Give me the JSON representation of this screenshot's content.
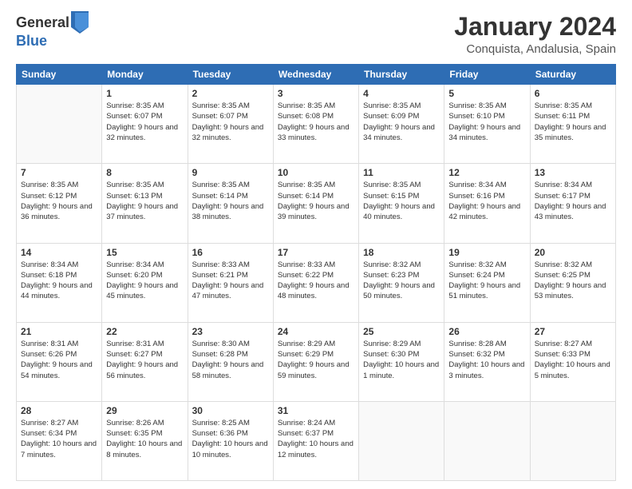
{
  "header": {
    "logo_general": "General",
    "logo_blue": "Blue",
    "month": "January 2024",
    "location": "Conquista, Andalusia, Spain"
  },
  "weekdays": [
    "Sunday",
    "Monday",
    "Tuesday",
    "Wednesday",
    "Thursday",
    "Friday",
    "Saturday"
  ],
  "weeks": [
    [
      {
        "day": "",
        "sunrise": "",
        "sunset": "",
        "daylight": ""
      },
      {
        "day": "1",
        "sunrise": "Sunrise: 8:35 AM",
        "sunset": "Sunset: 6:07 PM",
        "daylight": "Daylight: 9 hours and 32 minutes."
      },
      {
        "day": "2",
        "sunrise": "Sunrise: 8:35 AM",
        "sunset": "Sunset: 6:07 PM",
        "daylight": "Daylight: 9 hours and 32 minutes."
      },
      {
        "day": "3",
        "sunrise": "Sunrise: 8:35 AM",
        "sunset": "Sunset: 6:08 PM",
        "daylight": "Daylight: 9 hours and 33 minutes."
      },
      {
        "day": "4",
        "sunrise": "Sunrise: 8:35 AM",
        "sunset": "Sunset: 6:09 PM",
        "daylight": "Daylight: 9 hours and 34 minutes."
      },
      {
        "day": "5",
        "sunrise": "Sunrise: 8:35 AM",
        "sunset": "Sunset: 6:10 PM",
        "daylight": "Daylight: 9 hours and 34 minutes."
      },
      {
        "day": "6",
        "sunrise": "Sunrise: 8:35 AM",
        "sunset": "Sunset: 6:11 PM",
        "daylight": "Daylight: 9 hours and 35 minutes."
      }
    ],
    [
      {
        "day": "7",
        "sunrise": "Sunrise: 8:35 AM",
        "sunset": "Sunset: 6:12 PM",
        "daylight": "Daylight: 9 hours and 36 minutes."
      },
      {
        "day": "8",
        "sunrise": "Sunrise: 8:35 AM",
        "sunset": "Sunset: 6:13 PM",
        "daylight": "Daylight: 9 hours and 37 minutes."
      },
      {
        "day": "9",
        "sunrise": "Sunrise: 8:35 AM",
        "sunset": "Sunset: 6:14 PM",
        "daylight": "Daylight: 9 hours and 38 minutes."
      },
      {
        "day": "10",
        "sunrise": "Sunrise: 8:35 AM",
        "sunset": "Sunset: 6:14 PM",
        "daylight": "Daylight: 9 hours and 39 minutes."
      },
      {
        "day": "11",
        "sunrise": "Sunrise: 8:35 AM",
        "sunset": "Sunset: 6:15 PM",
        "daylight": "Daylight: 9 hours and 40 minutes."
      },
      {
        "day": "12",
        "sunrise": "Sunrise: 8:34 AM",
        "sunset": "Sunset: 6:16 PM",
        "daylight": "Daylight: 9 hours and 42 minutes."
      },
      {
        "day": "13",
        "sunrise": "Sunrise: 8:34 AM",
        "sunset": "Sunset: 6:17 PM",
        "daylight": "Daylight: 9 hours and 43 minutes."
      }
    ],
    [
      {
        "day": "14",
        "sunrise": "Sunrise: 8:34 AM",
        "sunset": "Sunset: 6:18 PM",
        "daylight": "Daylight: 9 hours and 44 minutes."
      },
      {
        "day": "15",
        "sunrise": "Sunrise: 8:34 AM",
        "sunset": "Sunset: 6:20 PM",
        "daylight": "Daylight: 9 hours and 45 minutes."
      },
      {
        "day": "16",
        "sunrise": "Sunrise: 8:33 AM",
        "sunset": "Sunset: 6:21 PM",
        "daylight": "Daylight: 9 hours and 47 minutes."
      },
      {
        "day": "17",
        "sunrise": "Sunrise: 8:33 AM",
        "sunset": "Sunset: 6:22 PM",
        "daylight": "Daylight: 9 hours and 48 minutes."
      },
      {
        "day": "18",
        "sunrise": "Sunrise: 8:32 AM",
        "sunset": "Sunset: 6:23 PM",
        "daylight": "Daylight: 9 hours and 50 minutes."
      },
      {
        "day": "19",
        "sunrise": "Sunrise: 8:32 AM",
        "sunset": "Sunset: 6:24 PM",
        "daylight": "Daylight: 9 hours and 51 minutes."
      },
      {
        "day": "20",
        "sunrise": "Sunrise: 8:32 AM",
        "sunset": "Sunset: 6:25 PM",
        "daylight": "Daylight: 9 hours and 53 minutes."
      }
    ],
    [
      {
        "day": "21",
        "sunrise": "Sunrise: 8:31 AM",
        "sunset": "Sunset: 6:26 PM",
        "daylight": "Daylight: 9 hours and 54 minutes."
      },
      {
        "day": "22",
        "sunrise": "Sunrise: 8:31 AM",
        "sunset": "Sunset: 6:27 PM",
        "daylight": "Daylight: 9 hours and 56 minutes."
      },
      {
        "day": "23",
        "sunrise": "Sunrise: 8:30 AM",
        "sunset": "Sunset: 6:28 PM",
        "daylight": "Daylight: 9 hours and 58 minutes."
      },
      {
        "day": "24",
        "sunrise": "Sunrise: 8:29 AM",
        "sunset": "Sunset: 6:29 PM",
        "daylight": "Daylight: 9 hours and 59 minutes."
      },
      {
        "day": "25",
        "sunrise": "Sunrise: 8:29 AM",
        "sunset": "Sunset: 6:30 PM",
        "daylight": "Daylight: 10 hours and 1 minute."
      },
      {
        "day": "26",
        "sunrise": "Sunrise: 8:28 AM",
        "sunset": "Sunset: 6:32 PM",
        "daylight": "Daylight: 10 hours and 3 minutes."
      },
      {
        "day": "27",
        "sunrise": "Sunrise: 8:27 AM",
        "sunset": "Sunset: 6:33 PM",
        "daylight": "Daylight: 10 hours and 5 minutes."
      }
    ],
    [
      {
        "day": "28",
        "sunrise": "Sunrise: 8:27 AM",
        "sunset": "Sunset: 6:34 PM",
        "daylight": "Daylight: 10 hours and 7 minutes."
      },
      {
        "day": "29",
        "sunrise": "Sunrise: 8:26 AM",
        "sunset": "Sunset: 6:35 PM",
        "daylight": "Daylight: 10 hours and 8 minutes."
      },
      {
        "day": "30",
        "sunrise": "Sunrise: 8:25 AM",
        "sunset": "Sunset: 6:36 PM",
        "daylight": "Daylight: 10 hours and 10 minutes."
      },
      {
        "day": "31",
        "sunrise": "Sunrise: 8:24 AM",
        "sunset": "Sunset: 6:37 PM",
        "daylight": "Daylight: 10 hours and 12 minutes."
      },
      {
        "day": "",
        "sunrise": "",
        "sunset": "",
        "daylight": ""
      },
      {
        "day": "",
        "sunrise": "",
        "sunset": "",
        "daylight": ""
      },
      {
        "day": "",
        "sunrise": "",
        "sunset": "",
        "daylight": ""
      }
    ]
  ]
}
